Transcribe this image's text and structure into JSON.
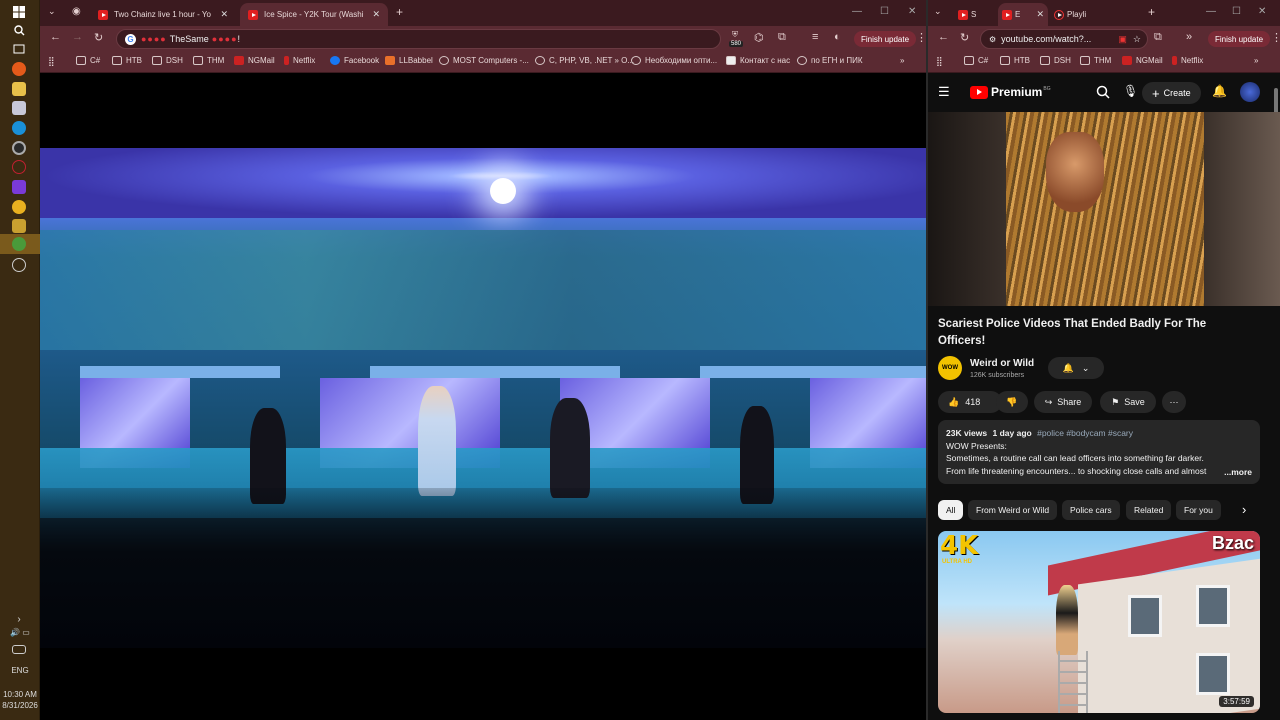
{
  "taskbar": {
    "language": "ENG",
    "time": "10:30 AM",
    "date": "8/31/2026"
  },
  "left_browser": {
    "tabs": [
      {
        "label": "Two Chainz live 1 hour - Yo"
      },
      {
        "label": "Ice Spice - Y2K Tour (Washi"
      }
    ],
    "omnibox_text": "TheSame",
    "omnibox_suffix": "!",
    "extension_badge": "580",
    "finish_update": "Finish update",
    "bookmarks": [
      {
        "label": "C#"
      },
      {
        "label": "HTB"
      },
      {
        "label": "DSH"
      },
      {
        "label": "THM"
      },
      {
        "label": "NGMail"
      },
      {
        "label": "Netflix"
      },
      {
        "label": "Facebook"
      },
      {
        "label": "LLBabbel"
      },
      {
        "label": "MOST Computers -..."
      },
      {
        "label": "C, PHP, VB, .NET » O..."
      },
      {
        "label": "Необходими опти..."
      },
      {
        "label": "Контакт с нас"
      },
      {
        "label": "по ЕГН и ПИК"
      }
    ]
  },
  "right_browser": {
    "tabs": [
      {
        "label": "S"
      },
      {
        "label": "E"
      },
      {
        "label": "Playli"
      }
    ],
    "url": "youtube.com/watch?...",
    "finish_update": "Finish update",
    "bookmarks": [
      {
        "label": "C#"
      },
      {
        "label": "HTB"
      },
      {
        "label": "DSH"
      },
      {
        "label": "THM"
      },
      {
        "label": "NGMail"
      },
      {
        "label": "Netflix"
      }
    ]
  },
  "youtube": {
    "brand": "Premium",
    "brand_sup": "BG",
    "create_label": "Create",
    "video_title": "Scariest Police Videos That Ended Badly For The Officers!",
    "channel_name": "Weird or Wild",
    "channel_avatar": "WOW",
    "subscribers": "126K subscribers",
    "likes": "418",
    "share_label": "Share",
    "save_label": "Save",
    "description": {
      "views": "23K views",
      "age": "1 day ago",
      "tags": "#police #bodycam #scary",
      "line1": "WOW Presents:",
      "line2": "Sometimes, a routine call can lead officers into something far darker.",
      "line3": "From life threatening encounters... to shocking close calls and almost",
      "more": "...more"
    },
    "chips": [
      {
        "label": "All"
      },
      {
        "label": "From Weird or Wild"
      },
      {
        "label": "Police cars"
      },
      {
        "label": "Related"
      },
      {
        "label": "For you"
      }
    ],
    "next_thumb": {
      "badge": "4K",
      "badge_sub": "ULTRA HD",
      "brand": "Bzac",
      "duration": "3:57:59"
    }
  },
  "colors": {
    "browser_frame": "#3b1a1f",
    "browser_toolbar": "#5a2a32",
    "youtube_bg": "#0f0f0f",
    "youtube_red": "#ff0000",
    "taskbar": "#3a2a12"
  }
}
